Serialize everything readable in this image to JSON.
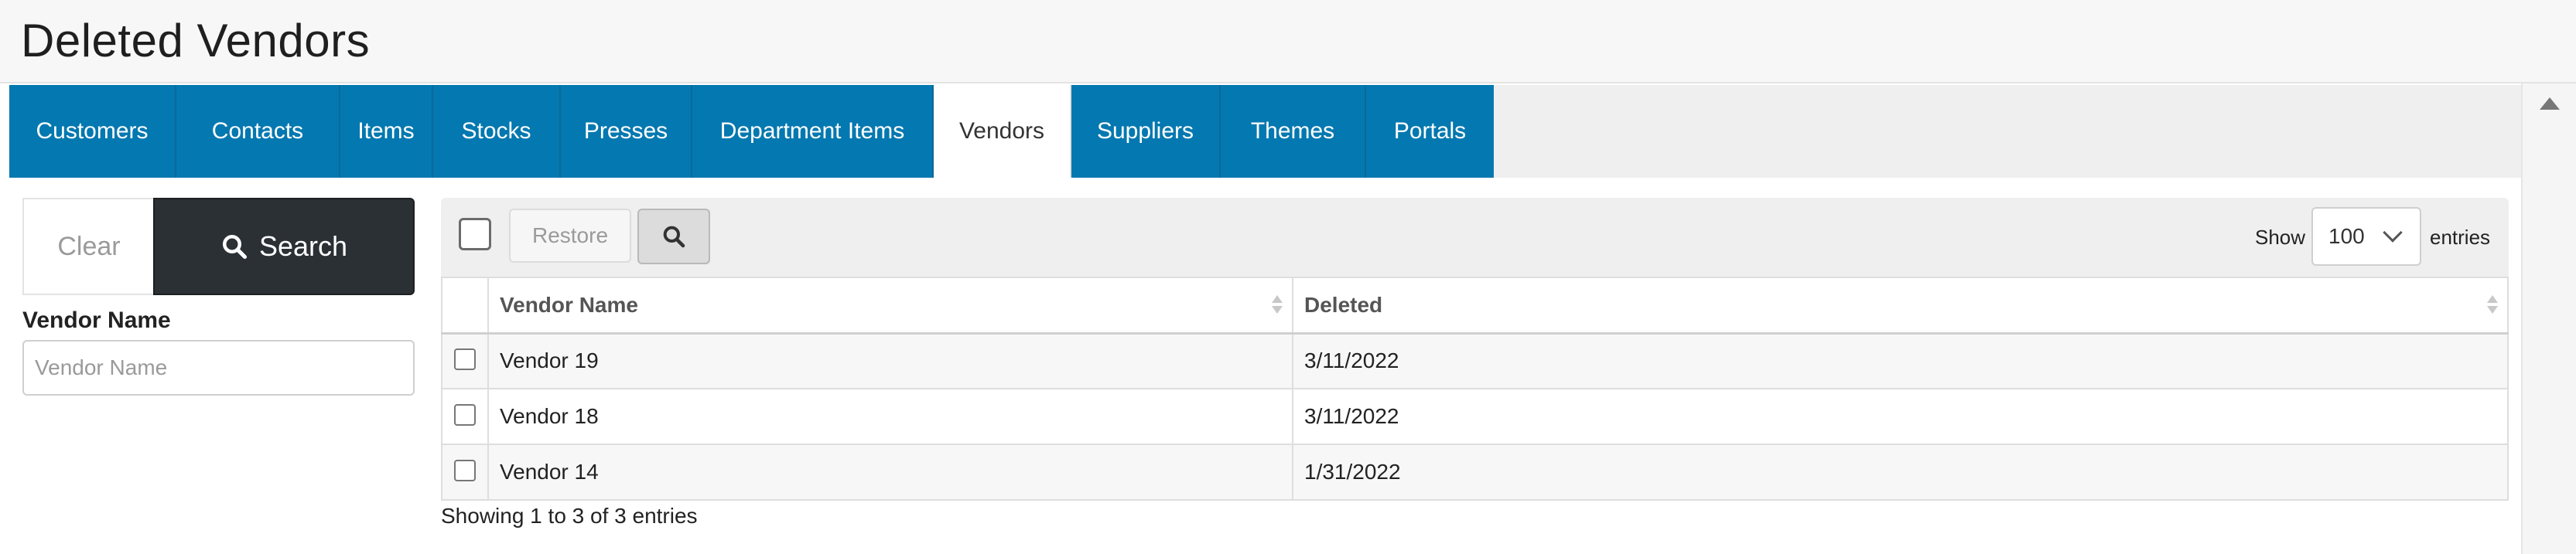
{
  "page": {
    "title": "Deleted Vendors"
  },
  "tabs": [
    {
      "label": "Customers",
      "active": false
    },
    {
      "label": "Contacts",
      "active": false
    },
    {
      "label": "Items",
      "active": false
    },
    {
      "label": "Stocks",
      "active": false
    },
    {
      "label": "Presses",
      "active": false
    },
    {
      "label": "Department Items",
      "active": false
    },
    {
      "label": "Vendors",
      "active": true
    },
    {
      "label": "Suppliers",
      "active": false
    },
    {
      "label": "Themes",
      "active": false
    },
    {
      "label": "Portals",
      "active": false
    }
  ],
  "filters": {
    "clear_label": "Clear",
    "search_label": "Search",
    "vendor_name_label": "Vendor Name",
    "vendor_name_placeholder": "Vendor Name",
    "vendor_name_value": ""
  },
  "toolbar": {
    "restore_label": "Restore",
    "show_label": "Show",
    "entries_value": "100",
    "entries_label": "entries"
  },
  "table": {
    "columns": [
      "Vendor Name",
      "Deleted"
    ],
    "rows": [
      {
        "vendor": "Vendor 19",
        "deleted": "3/11/2022"
      },
      {
        "vendor": "Vendor 18",
        "deleted": "3/11/2022"
      },
      {
        "vendor": "Vendor 14",
        "deleted": "1/31/2022"
      }
    ],
    "info": "Showing 1 to 3 of 3 entries"
  },
  "colors": {
    "tab_bg": "#0478b0",
    "search_button_bg": "#2b3035"
  },
  "icons": {
    "search": "search-icon",
    "scroll_up": "scroll-up-arrow-icon",
    "sort": "sort-icon",
    "dropdown": "chevron-down-icon"
  }
}
